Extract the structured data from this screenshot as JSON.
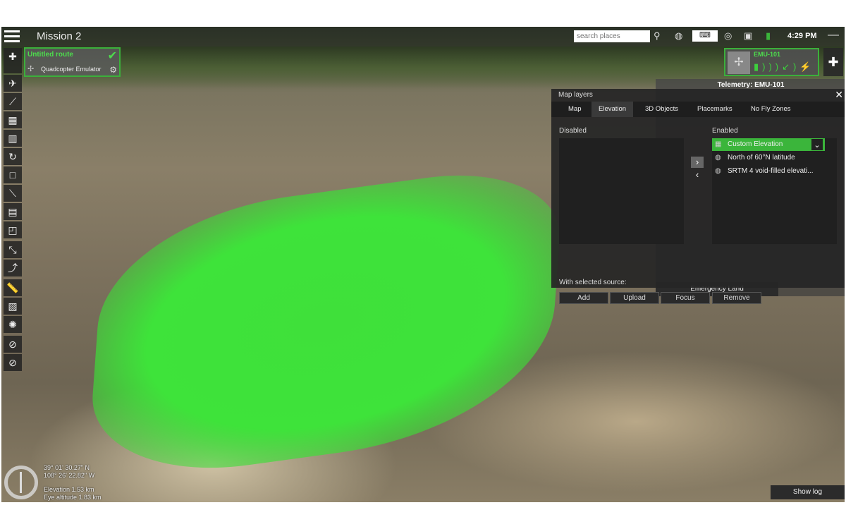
{
  "header": {
    "title": "Mission 2",
    "search_placeholder": "search places",
    "time": "4:29 PM"
  },
  "route": {
    "name": "Untitled route",
    "vehicle": "Quadcopter Emulator"
  },
  "vehicle": {
    "name": "EMU-101"
  },
  "telemetry": {
    "title": "Telemetry: EMU-101",
    "emergency_label": "Emergency Land"
  },
  "map_layers": {
    "title": "Map layers",
    "tabs": [
      {
        "label": "Map"
      },
      {
        "label": "Elevation"
      },
      {
        "label": "3D Objects"
      },
      {
        "label": "Placemarks"
      },
      {
        "label": "No Fly Zones"
      }
    ],
    "disabled_label": "Disabled",
    "enabled_label": "Enabled",
    "enabled_items": [
      {
        "label": "Custom Elevation"
      },
      {
        "label": "North of 60°N latitude"
      },
      {
        "label": "SRTM 4 void-filled elevati..."
      }
    ],
    "selected_source_label": "With selected source:",
    "buttons": {
      "add": "Add",
      "upload": "Upload",
      "focus": "Focus",
      "remove": "Remove"
    }
  },
  "status": {
    "lat": "39° 01' 30.27\" N",
    "lon": "108° 26' 22.82\" W",
    "elevation": "Elevation 1.53 km",
    "eye_altitude": "Eye altitude 1.83 km"
  },
  "show_log": "Show log",
  "colors": {
    "accent": "#3bb53b"
  }
}
